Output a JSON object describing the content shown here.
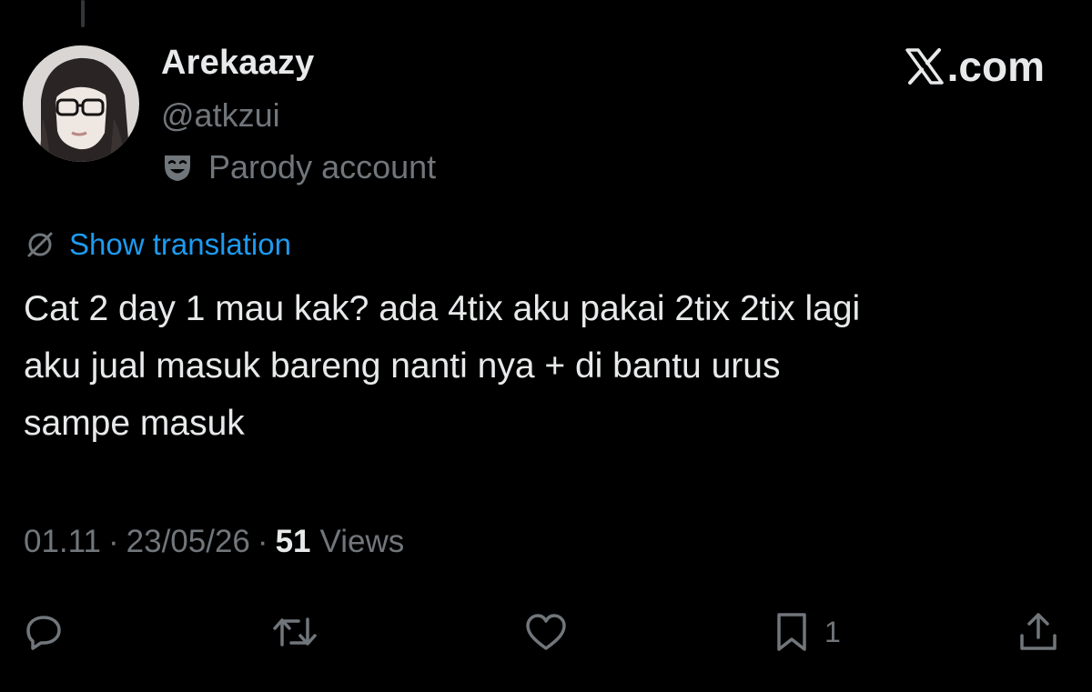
{
  "author": {
    "display_name": "Arekaazy",
    "handle": "@atkzui",
    "badge_label": "Parody account",
    "badge_icon": "theater-mask-icon",
    "avatar_icon": "profile-photo"
  },
  "brand": {
    "label": ".com",
    "icon": "x-logo-icon"
  },
  "translation": {
    "label": "Show translation",
    "icon": "globe-translate-icon"
  },
  "tweet": {
    "text": "Cat 2 day 1 mau kak? ada 4tix aku pakai 2tix 2tix lagi\naku jual masuk bareng nanti nya + di bantu urus\nsampe masuk"
  },
  "meta": {
    "time": "01.11",
    "separator": "·",
    "date": "23/05/26",
    "views_count": "51",
    "views_label": "Views"
  },
  "actions": {
    "reply": {
      "icon": "reply-icon",
      "count": ""
    },
    "retweet": {
      "icon": "retweet-icon",
      "count": ""
    },
    "like": {
      "icon": "heart-icon",
      "count": ""
    },
    "bookmark": {
      "icon": "bookmark-icon",
      "count": "1"
    },
    "share": {
      "icon": "share-icon",
      "count": ""
    }
  },
  "colors": {
    "background": "#000000",
    "primary_text": "#e7e9ea",
    "secondary_text": "#71767b",
    "link": "#1d9bf0"
  }
}
